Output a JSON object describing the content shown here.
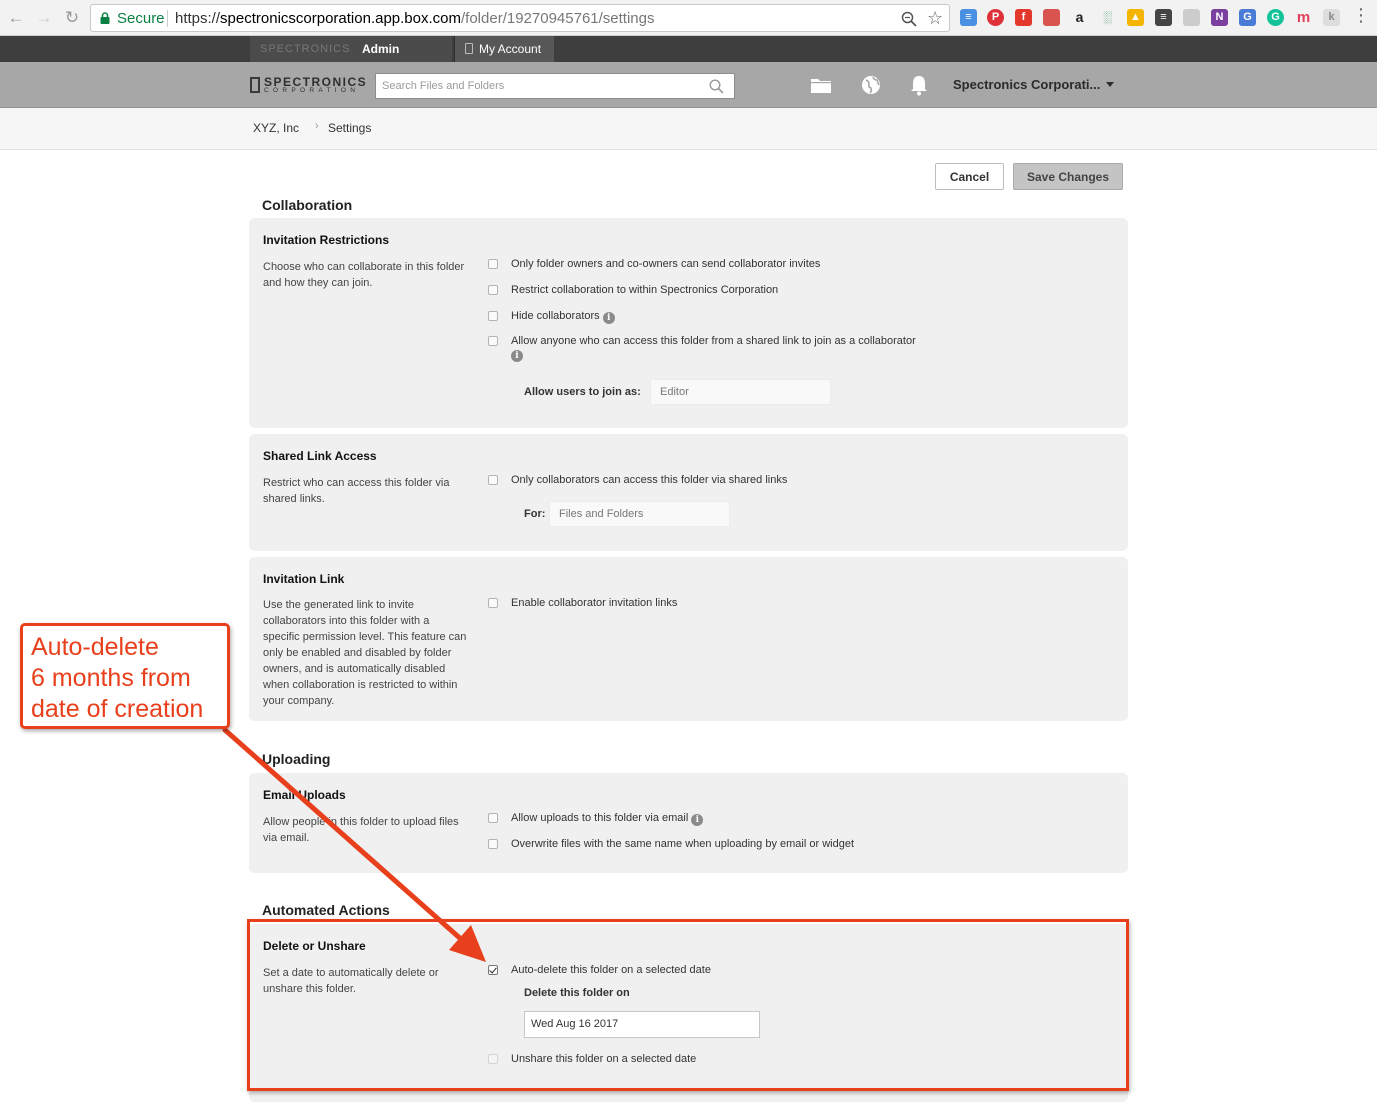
{
  "browser": {
    "secure_label": "Secure",
    "url_scheme": "https://",
    "url_host": "spectronicscorporation.app.box.com",
    "url_path": "/folder/19270945761/settings"
  },
  "topstrip": {
    "logo_text": "SPECTRONICS",
    "admin_console": "Admin Console",
    "my_account": "My Account"
  },
  "header": {
    "brand_name": "SPECTRONICS",
    "brand_sub": "CORPORATION",
    "search_placeholder": "Search Files and Folders",
    "account_name": "Spectronics Corporati..."
  },
  "breadcrumb": {
    "items": [
      "XYZ, Inc",
      "Settings"
    ],
    "separator": "›"
  },
  "actions": {
    "cancel": "Cancel",
    "save": "Save Changes"
  },
  "collaboration": {
    "title": "Collaboration",
    "invitation_restrictions": {
      "title": "Invitation Restrictions",
      "description": "Choose who can collaborate in this folder and how they can join.",
      "options": [
        {
          "label": "Only folder owners and co-owners can send collaborator invites",
          "checked": false
        },
        {
          "label": "Restrict collaboration to within Spectronics Corporation",
          "checked": false
        },
        {
          "label": "Hide collaborators",
          "checked": false
        },
        {
          "label": "Allow anyone who can access this folder from a shared link to join as a collaborator",
          "checked": false
        }
      ],
      "join_as_label": "Allow users to join as:",
      "join_as_value": "Editor"
    },
    "shared_link_access": {
      "title": "Shared Link Access",
      "description": "Restrict who can access this folder via shared links.",
      "option": "Only collaborators can access this folder via shared links",
      "for_label": "For:",
      "for_value": "Files and Folders"
    },
    "invitation_link": {
      "title": "Invitation Link",
      "description": "Use the generated link to invite collaborators into this folder with a specific permission level. This feature can only be enabled and disabled by folder owners, and is automatically disabled when collaboration is restricted to within your company.",
      "option": "Enable collaborator invitation links"
    }
  },
  "uploading": {
    "title": "Uploading",
    "email_uploads": {
      "title": "Email Uploads",
      "description": "Allow people in this folder to upload files via email.",
      "options": [
        {
          "label": "Allow uploads to this folder via email",
          "checked": false
        },
        {
          "label": "Overwrite files with the same name when uploading by email or widget",
          "checked": false
        }
      ]
    }
  },
  "automated_actions": {
    "title": "Automated Actions",
    "delete_or_unshare": {
      "title": "Delete or Unshare",
      "description": "Set a date to automatically delete or unshare this folder.",
      "auto_delete_label": "Auto-delete this folder on a selected date",
      "auto_delete_checked": true,
      "delete_on_label": "Delete this folder on",
      "delete_on_value": "Wed Aug 16 2017",
      "unshare_label": "Unshare this folder on a selected date",
      "unshare_checked": false
    }
  },
  "annotation": {
    "text": "Auto-delete\n6 months from\ndate of creation",
    "color": "#e8401c"
  }
}
